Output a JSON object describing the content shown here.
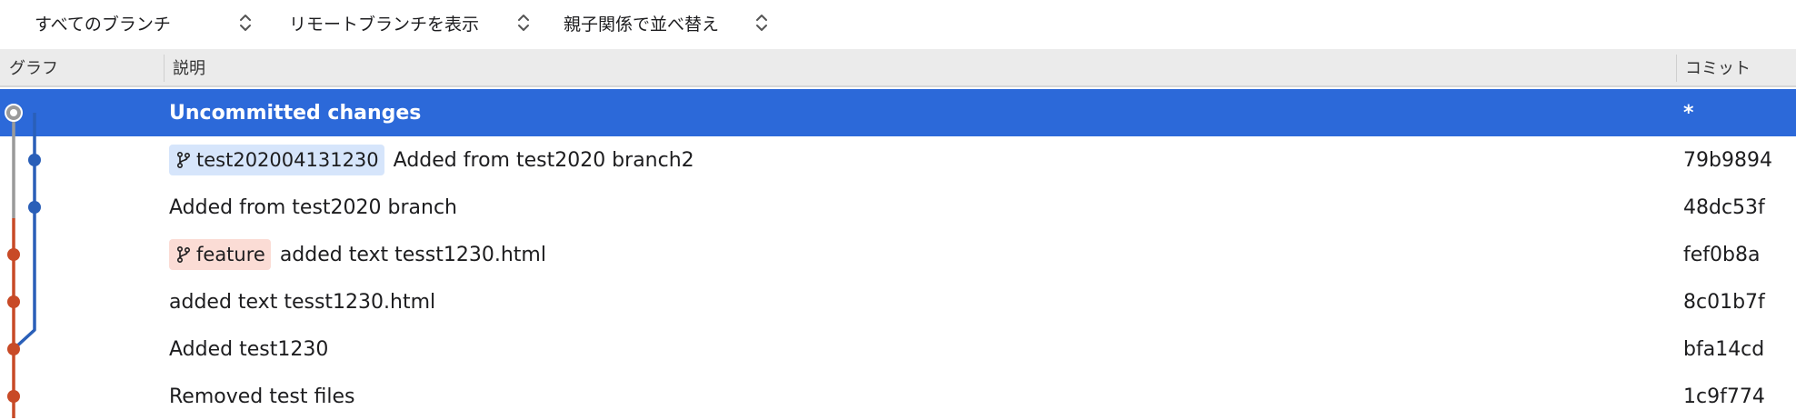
{
  "toolbar": {
    "branch_filter": "すべてのブランチ",
    "remote_filter": "リモートブランチを表示",
    "sort_order": "親子関係で並べ替え"
  },
  "columns": {
    "graph": "グラフ",
    "description": "説明",
    "commit": "コミット"
  },
  "rows": [
    {
      "description": "Uncommitted changes",
      "commit": "*"
    },
    {
      "branch": "test202004131230",
      "description": "Added from test2020 branch2",
      "commit": "79b9894"
    },
    {
      "description": "Added from test2020 branch",
      "commit": "48dc53f"
    },
    {
      "branch": "feature",
      "description": "added text tesst1230.html",
      "commit": "fef0b8a"
    },
    {
      "description": "added text tesst1230.html",
      "commit": "8c01b7f"
    },
    {
      "description": "Added test1230",
      "commit": "bfa14cd"
    },
    {
      "description": "Removed test files",
      "commit": "1c9f774"
    }
  ],
  "colors": {
    "selection": "#2c69d9",
    "graph_blue": "#2a5fb8",
    "graph_red": "#c84a27",
    "graph_gray": "#9a9a9a",
    "tag_blue_bg": "#d6e5fb",
    "tag_red_bg": "#fbdcd5"
  }
}
